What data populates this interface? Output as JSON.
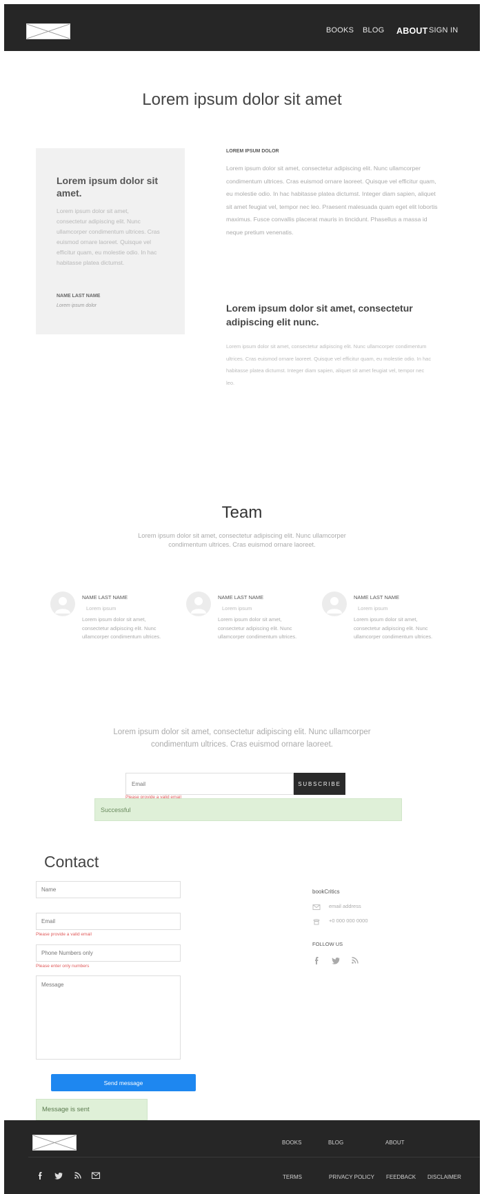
{
  "header": {
    "nav": {
      "books": "BOOKS",
      "blog": "BLOG",
      "about": "ABOUT",
      "signin": "SIGN IN"
    }
  },
  "hero": {
    "title": "Lorem ipsum dolor sit amet",
    "card": {
      "title": "Lorem ipsum dolor sit amet.",
      "text": "Lorem ipsum dolor sit amet, consectetur adipiscing elit. Nunc ullamcorper condimentum ultrices. Cras euismod ornare laoreet. Quisque vel efficitur quam, eu molestie odio. In hac habitasse platea dictumst.",
      "name": "NAME LAST NAME",
      "role": "Lorem ipsum dolor"
    },
    "info": {
      "label": "LOREM IPSUM DOLOR",
      "text": "Lorem ipsum dolor sit amet, consectetur adipiscing elit. Nunc ullamcorper condimentum ultrices. Cras euismod ornare laoreet. Quisque vel efficitur quam, eu molestie odio. In hac habitasse platea dictumst. Integer diam sapien, aliquet sit amet feugiat vel, tempor nec leo. Praesent malesuada quam eget elit lobortis maximus. Fusce convallis placerat mauris in tincidunt. Phasellus a massa id neque pretium venenatis.",
      "title": "Lorem ipsum dolor sit amet, consectetur adipiscing elit nunc.",
      "text2": "Lorem ipsum dolor sit amet, consectetur adipiscing elit. Nunc ullamcorper condimentum ultrices. Cras euismod ornare laoreet. Quisque vel efficitur quam, eu molestie odio. In hac habitasse platea dictumst. Integer diam sapien, aliquet sit amet feugiat vel, tempor nec leo."
    }
  },
  "team": {
    "title": "Team",
    "subtitle": "Lorem ipsum dolor sit amet, consectetur adipiscing elit. Nunc ullamcorper condimentum ultrices. Cras euismod ornare laoreet.",
    "members": [
      {
        "name": "NAME LAST NAME",
        "role": "Lorem ipsum",
        "text": "Lorem ipsum dolor sit amet, consectetur adipiscing elit. Nunc ullamcorper condimentum ultrices."
      },
      {
        "name": "NAME LAST NAME",
        "role": "Lorem ipsum",
        "text": "Lorem ipsum dolor sit amet, consectetur adipiscing elit. Nunc ullamcorper condimentum ultrices."
      },
      {
        "name": "NAME LAST NAME",
        "role": "Lorem ipsum",
        "text": "Lorem ipsum dolor sit amet, consectetur adipiscing elit. Nunc ullamcorper condimentum ultrices."
      }
    ]
  },
  "newsletter": {
    "text": "Lorem ipsum dolor sit amet, consectetur adipiscing elit. Nunc ullamcorper condimentum ultrices. Cras euismod ornare laoreet.",
    "email_placeholder": "Email",
    "subscribe_label": "SUBSCRIBE",
    "error": "Please provide a valid email",
    "success": "Successful"
  },
  "contact": {
    "title": "Contact",
    "name_placeholder": "Name",
    "email_placeholder": "Email",
    "email_error": "Please provide a valid email",
    "phone_placeholder": "Phone Numbers only",
    "phone_error": "Please enter only numbers",
    "message_placeholder": "Message",
    "send_label": "Send message",
    "sent": "Message is sent",
    "company": "bookCritics",
    "email_address": "email address",
    "phone": "+0 000 000 0000",
    "follow_label": "FOLLOW US",
    "icons": [
      "facebook-icon",
      "twitter-icon",
      "rss-icon"
    ]
  },
  "footer": {
    "nav": {
      "books": "BOOKS",
      "blog": "BLOG",
      "about": "ABOUT"
    },
    "links": {
      "terms": "TERMS",
      "privacy": "PRIVACY POLICY",
      "feedback": "FEEDBACK",
      "disclaimer": "DISCLAIMER"
    },
    "icons": [
      "facebook-icon",
      "twitter-icon",
      "rss-icon",
      "mail-icon"
    ]
  },
  "colors": {
    "header_bg": "#262626",
    "primary_button": "#1e87f0",
    "success_bg": "#dff0d8",
    "error_text": "#e05a5a"
  }
}
